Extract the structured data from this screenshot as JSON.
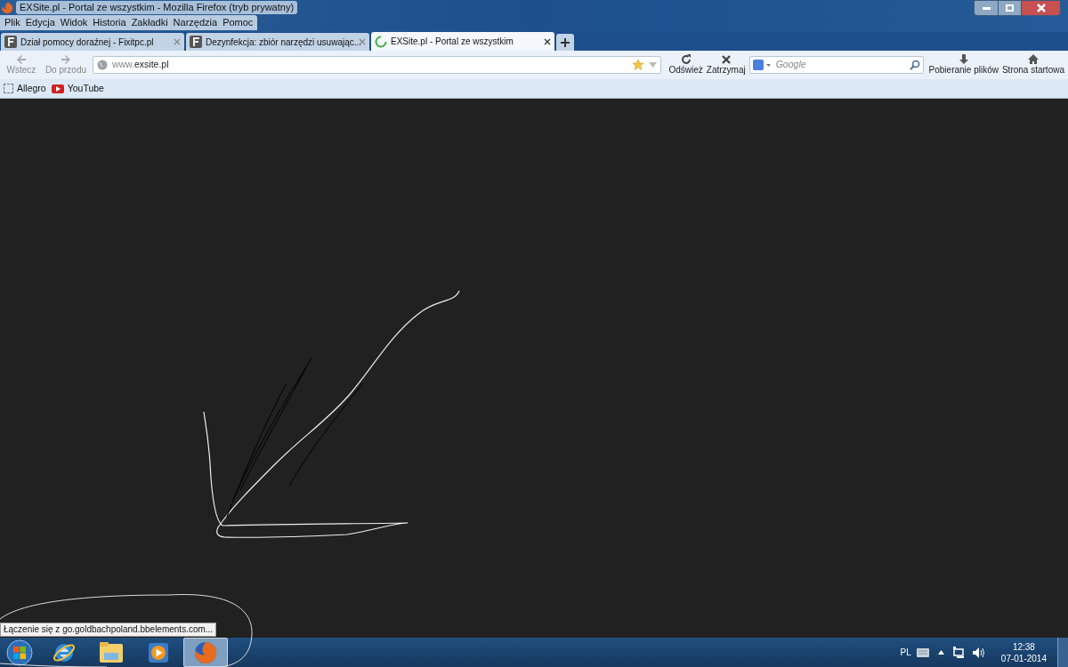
{
  "window": {
    "title": "EXSite.pl - Portal ze wszystkim - Mozilla Firefox (tryb prywatny)"
  },
  "menu": [
    "Plik",
    "Edycja",
    "Widok",
    "Historia",
    "Zakładki",
    "Narzędzia",
    "Pomoc"
  ],
  "tabs": [
    {
      "label": "Dział pomocy doraźnej - Fixitpc.pl",
      "selected": false,
      "loading": false
    },
    {
      "label": "Dezynfekcja: zbiór narzędzi usuwając...",
      "selected": false,
      "loading": false
    },
    {
      "label": "EXSite.pl - Portal ze wszystkim",
      "selected": true,
      "loading": true
    }
  ],
  "nav": {
    "back": "Wstecz",
    "forward": "Do przodu",
    "url_prefix": "www.",
    "url_domain": "exsite.pl",
    "reload": "Odśwież",
    "stop": "Zatrzymaj",
    "search_placeholder": "Google",
    "downloads": "Pobieranie plików",
    "home": "Strona startowa"
  },
  "bookmarks": [
    "Allegro",
    "YouTube"
  ],
  "status": "Łączenie się z go.goldbachpoland.bbelements.com...",
  "taskbar": {
    "apps": [
      {
        "kind": "ie",
        "selected": false
      },
      {
        "kind": "explorer",
        "selected": false
      },
      {
        "kind": "media",
        "selected": false
      },
      {
        "kind": "firefox",
        "selected": true
      }
    ],
    "language": "PL",
    "time": "12:38",
    "date": "07-01-2014"
  }
}
